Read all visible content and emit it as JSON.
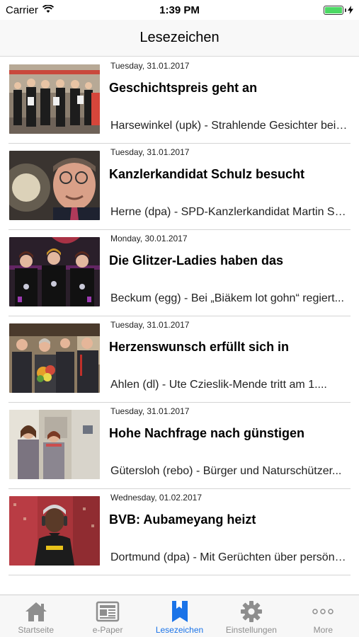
{
  "status": {
    "carrier": "Carrier",
    "time": "1:39 PM",
    "battery_level": 1.0,
    "battery_color": "#4cd964"
  },
  "nav": {
    "title": "Lesezeichen"
  },
  "articles": [
    {
      "date": "Tuesday, 31.01.2017",
      "headline": "Geschichtspreis geht an",
      "teaser": "Harsewinkel (upk) - Strahlende Gesichter bei den...",
      "image": "group-of-students-photo"
    },
    {
      "date": "Tuesday, 31.01.2017",
      "headline": "Kanzlerkandidat Schulz besucht",
      "teaser": "Herne (dpa) - SPD-Kanzlerkandidat Martin Schulz...",
      "image": "politician-portrait-photo"
    },
    {
      "date": "Monday, 30.01.2017",
      "headline": "Die Glitzer-Ladies haben das",
      "teaser": "Beckum (egg) - Bei „Biäkem lot gohn“ regiert...",
      "image": "carnival-ladies-photo"
    },
    {
      "date": "Tuesday, 31.01.2017",
      "headline": "Herzenswunsch erfüllt sich in",
      "teaser": "Ahlen (dl) - Ute Czieslik-Mende tritt am 1....",
      "image": "flower-bouquet-group-photo"
    },
    {
      "date": "Tuesday, 31.01.2017",
      "headline": "Hohe Nachfrage nach günstigen",
      "teaser": "Gütersloh (rebo) - Bürger und Naturschützer...",
      "image": "two-women-office-photo"
    },
    {
      "date": "Wednesday, 01.02.2017",
      "headline": "BVB: Aubameyang heizt",
      "teaser": "Dortmund (dpa) - Mit Gerüchten über persönliche...",
      "image": "football-player-photo"
    }
  ],
  "tabs": [
    {
      "label": "Startseite",
      "icon": "home-icon",
      "active": false
    },
    {
      "label": "e-Paper",
      "icon": "newspaper-icon",
      "active": false
    },
    {
      "label": "Lesezeichen",
      "icon": "bookmark-icon",
      "active": true
    },
    {
      "label": "Einstellungen",
      "icon": "gear-icon",
      "active": false
    },
    {
      "label": "More",
      "icon": "more-icon",
      "active": false
    }
  ],
  "colors": {
    "tab_active": "#1a73e8",
    "tab_inactive": "#8e8e8e"
  }
}
